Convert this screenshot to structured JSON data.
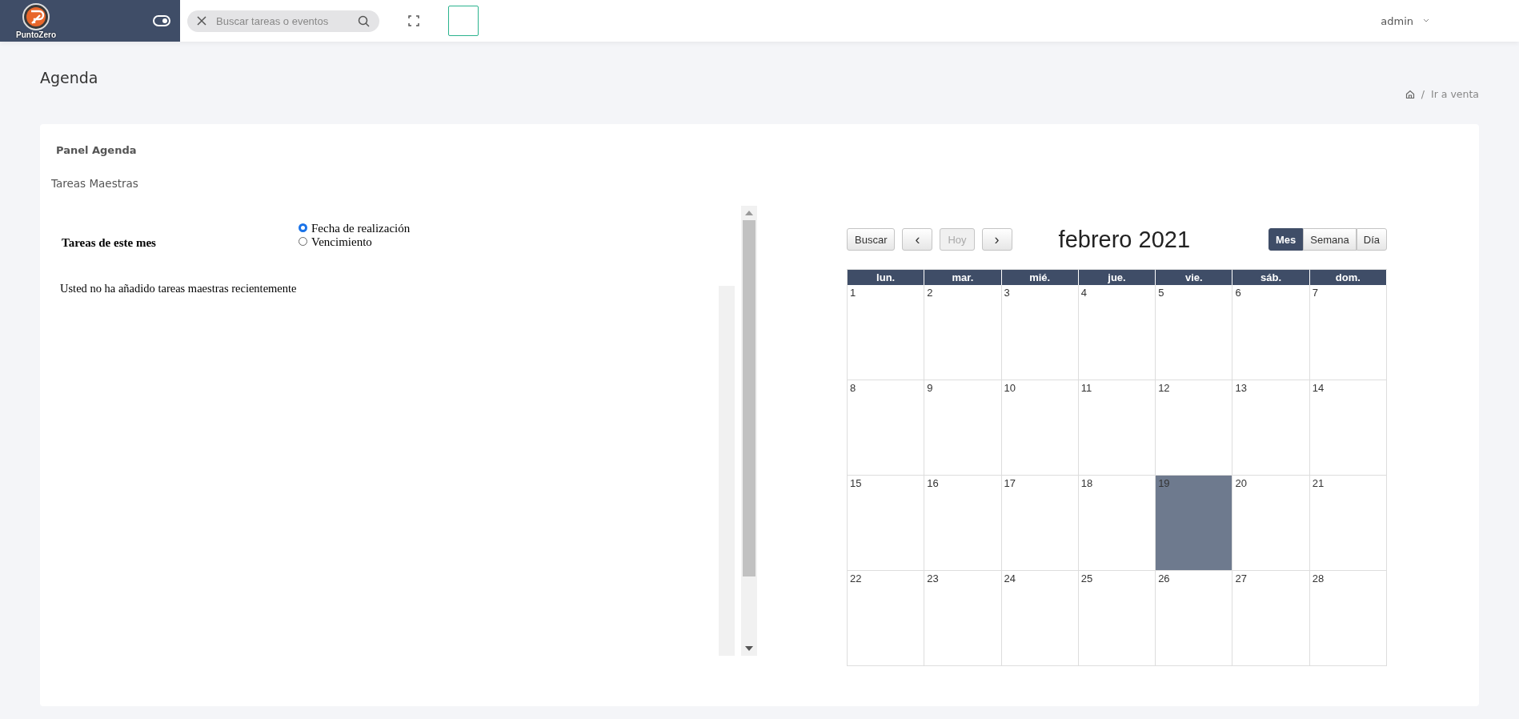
{
  "topbar": {
    "brand": "PuntoZero",
    "search": {
      "placeholder": "Buscar tareas o eventos"
    },
    "user": "admin"
  },
  "page": {
    "title": "Agenda",
    "breadcrumb": [
      {
        "separator": "/",
        "label": "Ir a venta"
      }
    ]
  },
  "panel": {
    "title": "Panel Agenda",
    "section": "Tareas Maestras",
    "heading": "Tareas de este mes",
    "radios": [
      {
        "label": "Fecha de realización",
        "selected": true
      },
      {
        "label": "Vencimiento",
        "selected": false
      }
    ],
    "message": "Usted no ha añadido tareas maestras recientemente"
  },
  "calendar": {
    "title": "febrero 2021",
    "buttons": [
      {
        "label": "Buscar",
        "disabled": false
      },
      {
        "label": "‹",
        "disabled": false
      },
      {
        "label": "Hoy",
        "disabled": true
      },
      {
        "label": "›",
        "disabled": false
      }
    ],
    "views": [
      {
        "label": "Mes",
        "selected": true
      },
      {
        "label": "Semana",
        "selected": false
      },
      {
        "label": "Día",
        "selected": false
      }
    ],
    "weekdays": [
      "lun.",
      "mar.",
      "mié.",
      "jue.",
      "vie.",
      "sáb.",
      "dom."
    ],
    "weeks": [
      [
        {
          "day": "1",
          "today": false
        },
        {
          "day": "2",
          "today": false
        },
        {
          "day": "3",
          "today": false
        },
        {
          "day": "4",
          "today": false
        },
        {
          "day": "5",
          "today": false
        },
        {
          "day": "6",
          "today": false
        },
        {
          "day": "7",
          "today": false
        }
      ],
      [
        {
          "day": "8",
          "today": false
        },
        {
          "day": "9",
          "today": false
        },
        {
          "day": "10",
          "today": false
        },
        {
          "day": "11",
          "today": false
        },
        {
          "day": "12",
          "today": false
        },
        {
          "day": "13",
          "today": false
        },
        {
          "day": "14",
          "today": false
        }
      ],
      [
        {
          "day": "15",
          "today": false
        },
        {
          "day": "16",
          "today": false
        },
        {
          "day": "17",
          "today": false
        },
        {
          "day": "18",
          "today": false
        },
        {
          "day": "19",
          "today": true
        },
        {
          "day": "20",
          "today": false
        },
        {
          "day": "21",
          "today": false
        }
      ],
      [
        {
          "day": "22",
          "today": false
        },
        {
          "day": "23",
          "today": false
        },
        {
          "day": "24",
          "today": false
        },
        {
          "day": "25",
          "today": false
        },
        {
          "day": "26",
          "today": false
        },
        {
          "day": "27",
          "today": false
        },
        {
          "day": "28",
          "today": false
        }
      ]
    ]
  }
}
